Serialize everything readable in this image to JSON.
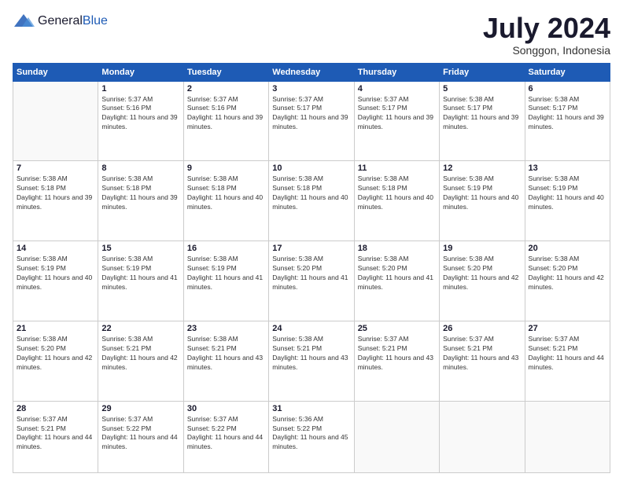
{
  "logo": {
    "general": "General",
    "blue": "Blue"
  },
  "header": {
    "title": "July 2024",
    "location": "Songgon, Indonesia"
  },
  "weekdays": [
    "Sunday",
    "Monday",
    "Tuesday",
    "Wednesday",
    "Thursday",
    "Friday",
    "Saturday"
  ],
  "weeks": [
    [
      {
        "day": "",
        "sunrise": "",
        "sunset": "",
        "daylight": ""
      },
      {
        "day": "1",
        "sunrise": "Sunrise: 5:37 AM",
        "sunset": "Sunset: 5:16 PM",
        "daylight": "Daylight: 11 hours and 39 minutes."
      },
      {
        "day": "2",
        "sunrise": "Sunrise: 5:37 AM",
        "sunset": "Sunset: 5:16 PM",
        "daylight": "Daylight: 11 hours and 39 minutes."
      },
      {
        "day": "3",
        "sunrise": "Sunrise: 5:37 AM",
        "sunset": "Sunset: 5:17 PM",
        "daylight": "Daylight: 11 hours and 39 minutes."
      },
      {
        "day": "4",
        "sunrise": "Sunrise: 5:37 AM",
        "sunset": "Sunset: 5:17 PM",
        "daylight": "Daylight: 11 hours and 39 minutes."
      },
      {
        "day": "5",
        "sunrise": "Sunrise: 5:38 AM",
        "sunset": "Sunset: 5:17 PM",
        "daylight": "Daylight: 11 hours and 39 minutes."
      },
      {
        "day": "6",
        "sunrise": "Sunrise: 5:38 AM",
        "sunset": "Sunset: 5:17 PM",
        "daylight": "Daylight: 11 hours and 39 minutes."
      }
    ],
    [
      {
        "day": "7",
        "sunrise": "Sunrise: 5:38 AM",
        "sunset": "Sunset: 5:18 PM",
        "daylight": "Daylight: 11 hours and 39 minutes."
      },
      {
        "day": "8",
        "sunrise": "Sunrise: 5:38 AM",
        "sunset": "Sunset: 5:18 PM",
        "daylight": "Daylight: 11 hours and 39 minutes."
      },
      {
        "day": "9",
        "sunrise": "Sunrise: 5:38 AM",
        "sunset": "Sunset: 5:18 PM",
        "daylight": "Daylight: 11 hours and 40 minutes."
      },
      {
        "day": "10",
        "sunrise": "Sunrise: 5:38 AM",
        "sunset": "Sunset: 5:18 PM",
        "daylight": "Daylight: 11 hours and 40 minutes."
      },
      {
        "day": "11",
        "sunrise": "Sunrise: 5:38 AM",
        "sunset": "Sunset: 5:18 PM",
        "daylight": "Daylight: 11 hours and 40 minutes."
      },
      {
        "day": "12",
        "sunrise": "Sunrise: 5:38 AM",
        "sunset": "Sunset: 5:19 PM",
        "daylight": "Daylight: 11 hours and 40 minutes."
      },
      {
        "day": "13",
        "sunrise": "Sunrise: 5:38 AM",
        "sunset": "Sunset: 5:19 PM",
        "daylight": "Daylight: 11 hours and 40 minutes."
      }
    ],
    [
      {
        "day": "14",
        "sunrise": "Sunrise: 5:38 AM",
        "sunset": "Sunset: 5:19 PM",
        "daylight": "Daylight: 11 hours and 40 minutes."
      },
      {
        "day": "15",
        "sunrise": "Sunrise: 5:38 AM",
        "sunset": "Sunset: 5:19 PM",
        "daylight": "Daylight: 11 hours and 41 minutes."
      },
      {
        "day": "16",
        "sunrise": "Sunrise: 5:38 AM",
        "sunset": "Sunset: 5:19 PM",
        "daylight": "Daylight: 11 hours and 41 minutes."
      },
      {
        "day": "17",
        "sunrise": "Sunrise: 5:38 AM",
        "sunset": "Sunset: 5:20 PM",
        "daylight": "Daylight: 11 hours and 41 minutes."
      },
      {
        "day": "18",
        "sunrise": "Sunrise: 5:38 AM",
        "sunset": "Sunset: 5:20 PM",
        "daylight": "Daylight: 11 hours and 41 minutes."
      },
      {
        "day": "19",
        "sunrise": "Sunrise: 5:38 AM",
        "sunset": "Sunset: 5:20 PM",
        "daylight": "Daylight: 11 hours and 42 minutes."
      },
      {
        "day": "20",
        "sunrise": "Sunrise: 5:38 AM",
        "sunset": "Sunset: 5:20 PM",
        "daylight": "Daylight: 11 hours and 42 minutes."
      }
    ],
    [
      {
        "day": "21",
        "sunrise": "Sunrise: 5:38 AM",
        "sunset": "Sunset: 5:20 PM",
        "daylight": "Daylight: 11 hours and 42 minutes."
      },
      {
        "day": "22",
        "sunrise": "Sunrise: 5:38 AM",
        "sunset": "Sunset: 5:21 PM",
        "daylight": "Daylight: 11 hours and 42 minutes."
      },
      {
        "day": "23",
        "sunrise": "Sunrise: 5:38 AM",
        "sunset": "Sunset: 5:21 PM",
        "daylight": "Daylight: 11 hours and 43 minutes."
      },
      {
        "day": "24",
        "sunrise": "Sunrise: 5:38 AM",
        "sunset": "Sunset: 5:21 PM",
        "daylight": "Daylight: 11 hours and 43 minutes."
      },
      {
        "day": "25",
        "sunrise": "Sunrise: 5:37 AM",
        "sunset": "Sunset: 5:21 PM",
        "daylight": "Daylight: 11 hours and 43 minutes."
      },
      {
        "day": "26",
        "sunrise": "Sunrise: 5:37 AM",
        "sunset": "Sunset: 5:21 PM",
        "daylight": "Daylight: 11 hours and 43 minutes."
      },
      {
        "day": "27",
        "sunrise": "Sunrise: 5:37 AM",
        "sunset": "Sunset: 5:21 PM",
        "daylight": "Daylight: 11 hours and 44 minutes."
      }
    ],
    [
      {
        "day": "28",
        "sunrise": "Sunrise: 5:37 AM",
        "sunset": "Sunset: 5:21 PM",
        "daylight": "Daylight: 11 hours and 44 minutes."
      },
      {
        "day": "29",
        "sunrise": "Sunrise: 5:37 AM",
        "sunset": "Sunset: 5:22 PM",
        "daylight": "Daylight: 11 hours and 44 minutes."
      },
      {
        "day": "30",
        "sunrise": "Sunrise: 5:37 AM",
        "sunset": "Sunset: 5:22 PM",
        "daylight": "Daylight: 11 hours and 44 minutes."
      },
      {
        "day": "31",
        "sunrise": "Sunrise: 5:36 AM",
        "sunset": "Sunset: 5:22 PM",
        "daylight": "Daylight: 11 hours and 45 minutes."
      },
      {
        "day": "",
        "sunrise": "",
        "sunset": "",
        "daylight": ""
      },
      {
        "day": "",
        "sunrise": "",
        "sunset": "",
        "daylight": ""
      },
      {
        "day": "",
        "sunrise": "",
        "sunset": "",
        "daylight": ""
      }
    ]
  ]
}
